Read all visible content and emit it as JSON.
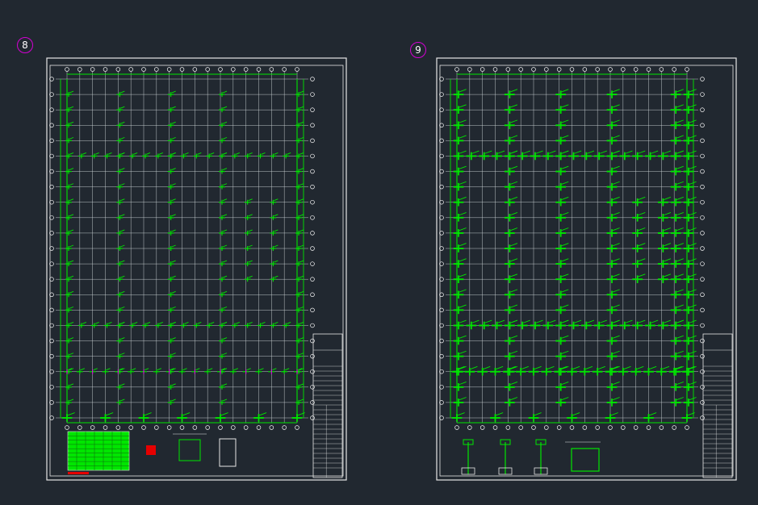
{
  "sheets": [
    {
      "id": "sheet-8",
      "label": "8",
      "ring_color": "#d400d4",
      "variant": "a"
    },
    {
      "id": "sheet-9",
      "label": "9",
      "ring_color": "#d400d4",
      "variant": "b"
    }
  ],
  "colors": {
    "background": "#212830",
    "frame": "#e6e6e6",
    "grid": "#cfd6d8",
    "member": "#00e600",
    "highlight": "#e600e6",
    "accent": "#e60000",
    "text": "#ffffff"
  }
}
